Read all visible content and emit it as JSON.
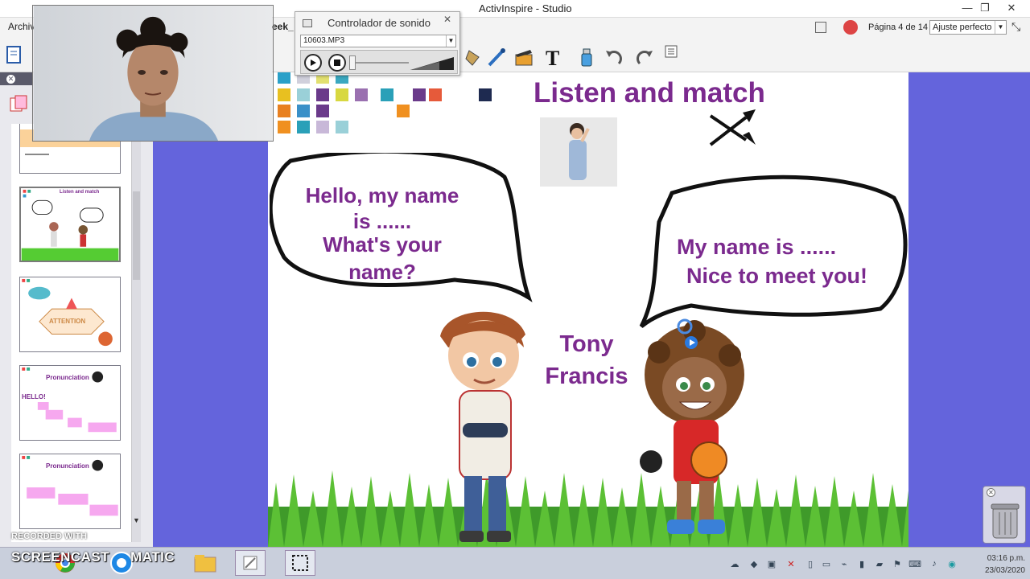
{
  "window": {
    "title": "ActivInspire - Studio"
  },
  "menu": {
    "file_label": "Archivo",
    "open_file_label": "eek_"
  },
  "navigation": {
    "page_indicator": "Página 4 de 14",
    "zoom_value": "Ajuste perfecto"
  },
  "sound_controller": {
    "title": "Controlador de sonido",
    "file_value": "10603.MP3"
  },
  "lesson": {
    "title": "Listen and match",
    "bubble_left": [
      "Hello, my name",
      "is ......",
      "What's your",
      "name?"
    ],
    "bubble_right": [
      "My name is ......",
      "Nice to meet you!"
    ],
    "name_tony": "Tony",
    "name_francis": "Francis"
  },
  "thumbnails": [
    {
      "label": "Listen and match"
    },
    {
      "label": "ATTENTION"
    },
    {
      "label": "Pronunciation",
      "sub": "HELLO!"
    },
    {
      "label": "Pronunciation"
    }
  ],
  "watermark": {
    "recorded": "RECORDED WITH",
    "brand_a": "SCREENCAST",
    "brand_b": "MATIC"
  },
  "clock": {
    "time": "03:16 p.m.",
    "date": "23/03/2020"
  },
  "colors": {
    "accent": "#7b2a8e",
    "desktop": "#6464dc"
  }
}
